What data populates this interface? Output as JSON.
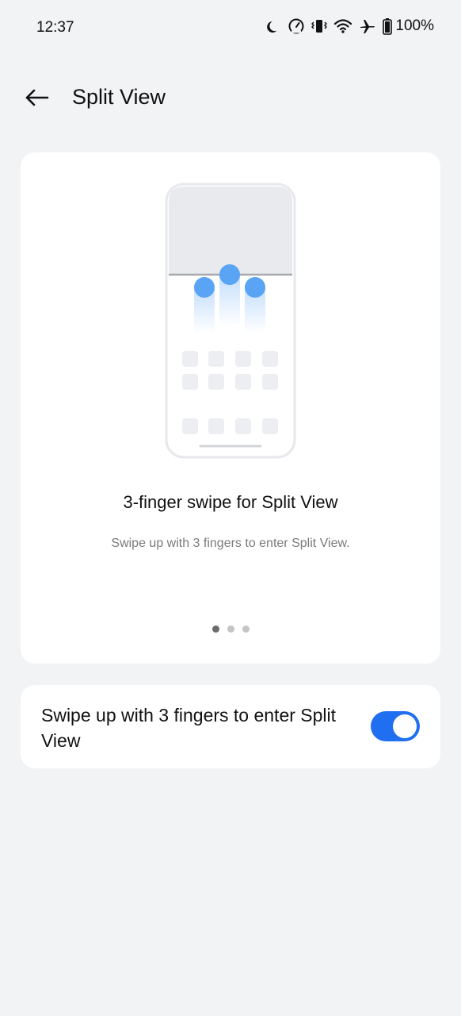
{
  "status_bar": {
    "time": "12:37",
    "battery_percent": "100%",
    "icons": [
      "moon-icon",
      "speedometer-icon",
      "vibrate-icon",
      "wifi-icon",
      "airplane-icon",
      "battery-icon"
    ]
  },
  "header": {
    "back_icon": "arrow-left-icon",
    "title": "Split View"
  },
  "intro_card": {
    "title": "3-finger swipe for Split View",
    "subtitle": "Swipe up with 3 fingers to enter Split View.",
    "pager": {
      "total": 3,
      "active_index": 0
    }
  },
  "setting": {
    "label": "Swipe up with 3 fingers to enter Split View",
    "enabled": true
  },
  "colors": {
    "background": "#f2f3f5",
    "card": "#ffffff",
    "accent": "#1f6ff0",
    "finger_dot": "#5aa4f5"
  }
}
